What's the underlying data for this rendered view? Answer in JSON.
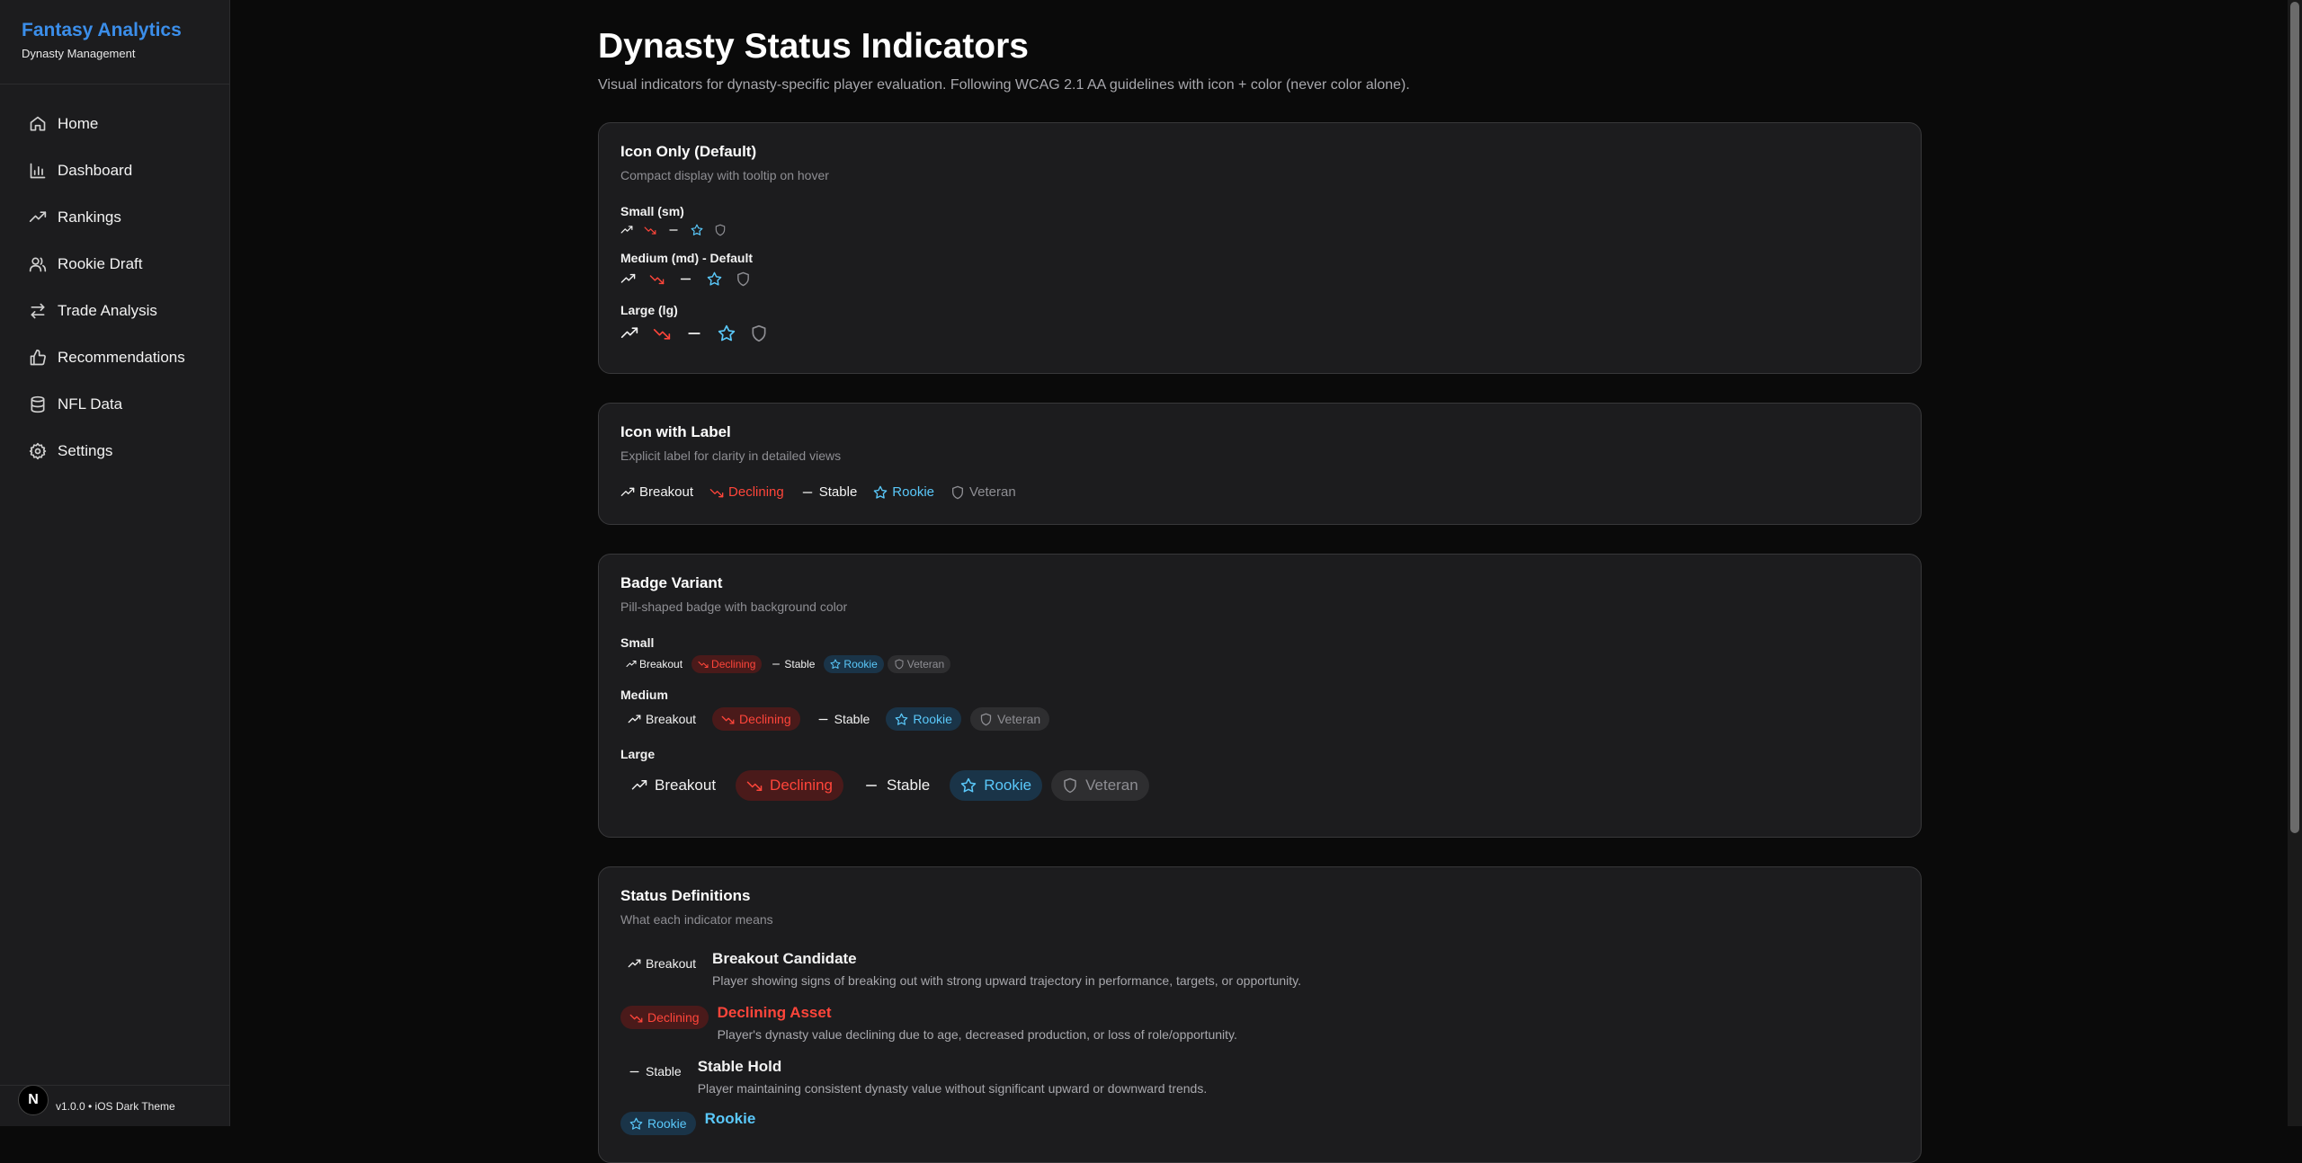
{
  "app": {
    "title": "Fantasy Analytics",
    "subtitle": "Dynasty Management",
    "footer": "v1.0.0 • iOS Dark Theme",
    "badge": "N"
  },
  "nav": [
    {
      "label": "Home",
      "icon": "home-icon"
    },
    {
      "label": "Dashboard",
      "icon": "bar-chart-icon"
    },
    {
      "label": "Rankings",
      "icon": "trending-up-icon"
    },
    {
      "label": "Rookie Draft",
      "icon": "users-icon"
    },
    {
      "label": "Trade Analysis",
      "icon": "swap-icon"
    },
    {
      "label": "Recommendations",
      "icon": "thumbs-up-icon"
    },
    {
      "label": "NFL Data",
      "icon": "database-icon"
    },
    {
      "label": "Settings",
      "icon": "gear-icon"
    }
  ],
  "page": {
    "title": "Dynasty Status Indicators",
    "subtitle": "Visual indicators for dynasty-specific player evaluation. Following WCAG 2.1 AA guidelines with icon + color (never color alone)."
  },
  "icon_only": {
    "title": "Icon Only (Default)",
    "subtitle": "Compact display with tooltip on hover",
    "small": "Small (sm)",
    "medium": "Medium (md) - Default",
    "large": "Large (lg)"
  },
  "icon_label": {
    "title": "Icon with Label",
    "subtitle": "Explicit label for clarity in detailed views"
  },
  "badge": {
    "title": "Badge Variant",
    "subtitle": "Pill-shaped badge with background color",
    "small": "Small",
    "medium": "Medium",
    "large": "Large"
  },
  "statuses": {
    "breakout": "Breakout",
    "declining": "Declining",
    "stable": "Stable",
    "rookie": "Rookie",
    "veteran": "Veteran"
  },
  "definitions": {
    "title": "Status Definitions",
    "subtitle": "What each indicator means",
    "items": [
      {
        "badge": "Breakout",
        "title": "Breakout Candidate",
        "desc": "Player showing signs of breaking out with strong upward trajectory in performance, targets, or opportunity."
      },
      {
        "badge": "Declining",
        "title": "Declining Asset",
        "desc": "Player's dynasty value declining due to age, decreased production, or loss of role/opportunity."
      },
      {
        "badge": "Stable",
        "title": "Stable Hold",
        "desc": "Player maintaining consistent dynasty value without significant upward or downward trends."
      },
      {
        "badge": "Rookie",
        "title": "Rookie",
        "desc": ""
      }
    ]
  },
  "colors": {
    "accent": "#3b8eea",
    "declining": "#ff453a",
    "rookie": "#5ac8fa",
    "veteran": "#8e8e93"
  }
}
